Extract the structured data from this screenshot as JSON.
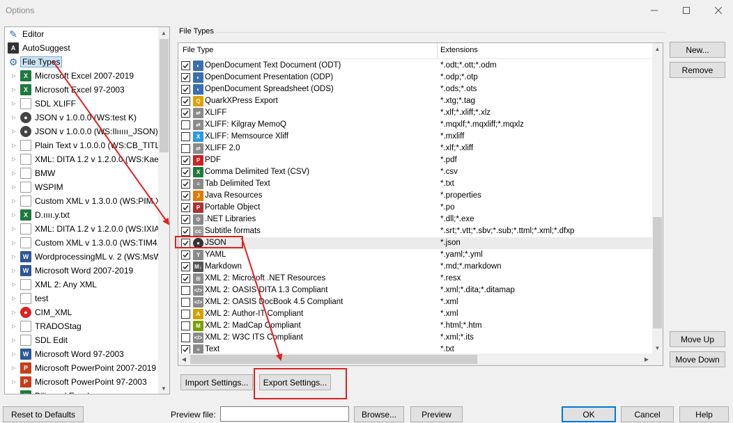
{
  "window": {
    "title": "Options"
  },
  "tree": {
    "items": [
      {
        "label": "Editor",
        "icon": "pencil-icon",
        "top": true
      },
      {
        "label": "AutoSuggest",
        "icon": "autosuggest-icon",
        "top": true
      },
      {
        "label": "File Types",
        "icon": "gear-icon",
        "top": true,
        "selected": true
      },
      {
        "label": "Microsoft Excel 2007-2019",
        "icon": "excel-icon"
      },
      {
        "label": "Microsoft Excel 97-2003",
        "icon": "excel-icon"
      },
      {
        "label": "SDL XLIFF",
        "icon": "document-icon"
      },
      {
        "label": "JSON v 1.0.0.0 (WS:test K)",
        "icon": "json-icon"
      },
      {
        "label": "JSON v 1.0.0.0 (WS:Ilııııı_JSON)",
        "icon": "json-icon"
      },
      {
        "label": "Plain Text v 1.0.0.0 (WS:CB_TITLE_T",
        "icon": "document-icon"
      },
      {
        "label": "XML: DITA 1.2 v 1.2.0.0 (WS:Kaeser",
        "icon": "document-icon"
      },
      {
        "label": "BMW",
        "icon": "document-icon"
      },
      {
        "label": "WSPIM",
        "icon": "document-icon"
      },
      {
        "label": "Custom XML v 1.3.0.0 (WS:PIM XLI",
        "icon": "document-icon"
      },
      {
        "label": "D.ıııı.y.txt",
        "icon": "excel-icon"
      },
      {
        "label": "XML: DITA 1.2 v 1.2.0.0 (WS:IXIASO",
        "icon": "document-icon"
      },
      {
        "label": "Custom XML v 1.3.0.0 (WS:TIM4.1)",
        "icon": "document-icon"
      },
      {
        "label": "WordprocessingML v. 2 (WS:MsWo",
        "icon": "word-icon"
      },
      {
        "label": "Microsoft Word 2007-2019",
        "icon": "word-icon"
      },
      {
        "label": "XML 2: Any XML",
        "icon": "document-icon"
      },
      {
        "label": "test",
        "icon": "document-icon"
      },
      {
        "label": "CIM_XML",
        "icon": "cim-icon"
      },
      {
        "label": "TRADOStag",
        "icon": "document-icon"
      },
      {
        "label": "SDL Edit",
        "icon": "document-icon"
      },
      {
        "label": "Microsoft Word 97-2003",
        "icon": "word-icon"
      },
      {
        "label": "Microsoft PowerPoint 2007-2019",
        "icon": "powerpoint-icon"
      },
      {
        "label": "Microsoft PowerPoint 97-2003",
        "icon": "powerpoint-icon"
      },
      {
        "label": "Bilingual Excel",
        "icon": "excel-icon"
      }
    ]
  },
  "group": {
    "title": "File Types"
  },
  "grid": {
    "columns": [
      "File Type",
      "Extensions"
    ],
    "rows": [
      {
        "name": "OpenDocument Text Document (ODT)",
        "ext": "*.odt;*.ott;*.odm",
        "checked": true,
        "icon": "odt-icon",
        "color": "#3a6fb0"
      },
      {
        "name": "OpenDocument Presentation (ODP)",
        "ext": "*.odp;*.otp",
        "checked": true,
        "icon": "odp-icon",
        "color": "#3a6fb0"
      },
      {
        "name": "OpenDocument Spreadsheet (ODS)",
        "ext": "*.ods;*.ots",
        "checked": true,
        "icon": "ods-icon",
        "color": "#3a6fb0"
      },
      {
        "name": "QuarkXPress Export",
        "ext": "*.xtg;*.tag",
        "checked": true,
        "icon": "quark-icon",
        "color": "#e0a000"
      },
      {
        "name": "XLIFF",
        "ext": "*.xlf;*.xliff;*.xlz",
        "checked": true,
        "icon": "xliff-icon",
        "color": "#8a8a8a"
      },
      {
        "name": "XLIFF: Kilgray MemoQ",
        "ext": "*.mqxlf;*.mqxliff;*.mqxlz",
        "checked": false,
        "icon": "xliff-icon",
        "color": "#8a8a8a"
      },
      {
        "name": "XLIFF: Memsource Xliff",
        "ext": "*.mxliff",
        "checked": false,
        "icon": "memsource-icon",
        "color": "#2b9be0"
      },
      {
        "name": "XLIFF 2.0",
        "ext": "*.xlf;*.xliff",
        "checked": false,
        "icon": "xliff-icon",
        "color": "#8a8a8a"
      },
      {
        "name": "PDF",
        "ext": "*.pdf",
        "checked": true,
        "icon": "pdf-icon",
        "color": "#cc2222"
      },
      {
        "name": "Comma Delimited Text (CSV)",
        "ext": "*.csv",
        "checked": true,
        "icon": "csv-icon",
        "color": "#1d7a3e"
      },
      {
        "name": "Tab Delimited Text",
        "ext": "*.txt",
        "checked": true,
        "icon": "text-icon",
        "color": "#8a8a8a"
      },
      {
        "name": "Java Resources",
        "ext": "*.properties",
        "checked": true,
        "icon": "java-icon",
        "color": "#e07a00"
      },
      {
        "name": "Portable Object",
        "ext": "*.po",
        "checked": true,
        "icon": "po-icon",
        "color": "#b03030"
      },
      {
        "name": ".NET Libraries",
        "ext": "*.dll;*.exe",
        "checked": true,
        "icon": "dotnet-icon",
        "color": "#8a8a8a"
      },
      {
        "name": "Subtitle formats",
        "ext": "*.srt;*.vtt;*.sbv;*.sub;*.ttml;*.xml;*.dfxp",
        "checked": true,
        "icon": "subtitle-icon",
        "color": "#9a9a9a"
      },
      {
        "name": "JSON",
        "ext": "*.json",
        "checked": true,
        "icon": "json-icon",
        "color": "#333333",
        "highlighted": true
      },
      {
        "name": "YAML",
        "ext": "*.yaml;*.yml",
        "checked": true,
        "icon": "yaml-icon",
        "color": "#8a8a8a"
      },
      {
        "name": "Markdown",
        "ext": "*.md;*.markdown",
        "checked": true,
        "icon": "markdown-icon",
        "color": "#555555"
      },
      {
        "name": "XML 2: Microsoft .NET Resources",
        "ext": "*.resx",
        "checked": true,
        "icon": "resx-icon",
        "color": "#8a8a8a"
      },
      {
        "name": "XML 2: OASIS DITA 1.3 Compliant",
        "ext": "*.xml;*.dita;*.ditamap",
        "checked": false,
        "icon": "xml-icon",
        "color": "#8a8a8a"
      },
      {
        "name": "XML 2: OASIS DocBook 4.5 Compliant",
        "ext": "*.xml",
        "checked": false,
        "icon": "xml-icon",
        "color": "#8a8a8a"
      },
      {
        "name": "XML 2: Author-IT Compliant",
        "ext": "*.xml",
        "checked": false,
        "icon": "authorit-icon",
        "color": "#d4a000"
      },
      {
        "name": "XML 2: MadCap Compliant",
        "ext": "*.html;*.htm",
        "checked": false,
        "icon": "madcap-icon",
        "color": "#7aa000"
      },
      {
        "name": "XML 2: W3C ITS Compliant",
        "ext": "*.xml;*.its",
        "checked": false,
        "icon": "xml-icon",
        "color": "#8a8a8a"
      },
      {
        "name": "Text",
        "ext": "*.txt",
        "checked": true,
        "icon": "text-icon",
        "color": "#8a8a8a"
      }
    ]
  },
  "buttons": {
    "new": "New...",
    "remove": "Remove",
    "move_up": "Move Up",
    "move_down": "Move Down",
    "import": "Import Settings...",
    "export": "Export Settings...",
    "reset": "Reset to Defaults",
    "browse": "Browse...",
    "preview": "Preview",
    "ok": "OK",
    "cancel": "Cancel",
    "help": "Help"
  },
  "preview": {
    "label": "Preview file:",
    "value": ""
  },
  "colors": {
    "annotation": "#e02020",
    "selection": "#cce4f7",
    "accent": "#0078d7"
  }
}
